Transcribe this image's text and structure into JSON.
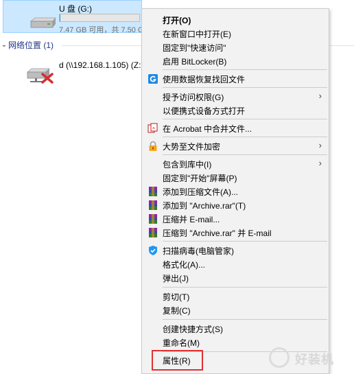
{
  "explorer": {
    "drive": {
      "name": "U 盘 (G:)",
      "info": "7.47 GB 可用，共 7.50 GB",
      "used_fraction": 0.01
    },
    "network_group": {
      "label": "网络位置 (1)"
    },
    "network_drive": {
      "label": "d (\\\\192.168.1.105) (Z:)"
    }
  },
  "menu": {
    "items": [
      {
        "label": "打开(O)"
      },
      {
        "label": "在新窗口中打开(E)"
      },
      {
        "label": "固定到\"快速访问\""
      },
      {
        "label": "启用 BitLocker(B)"
      },
      {
        "label": "使用数据恢复找回文件",
        "icon": "recovery-icon"
      },
      {
        "label": "授予访问权限(G)",
        "submenu": true
      },
      {
        "label": "以便携式设备方式打开"
      },
      {
        "label": "在 Acrobat 中合并文件...",
        "icon": "acrobat-icon"
      },
      {
        "label": "大势至文件加密",
        "icon": "lock-icon",
        "submenu": true
      },
      {
        "label": "包含到库中(I)",
        "submenu": true
      },
      {
        "label": "固定到\"开始\"屏幕(P)"
      },
      {
        "label": "添加到压缩文件(A)...",
        "icon": "winrar-icon"
      },
      {
        "label": "添加到 \"Archive.rar\"(T)",
        "icon": "winrar-icon"
      },
      {
        "label": "压缩并 E-mail...",
        "icon": "winrar-icon"
      },
      {
        "label": "压缩到 \"Archive.rar\" 并 E-mail",
        "icon": "winrar-icon"
      },
      {
        "label": "扫描病毒(电脑管家)",
        "icon": "shield-icon"
      },
      {
        "label": "格式化(A)..."
      },
      {
        "label": "弹出(J)"
      },
      {
        "label": "剪切(T)"
      },
      {
        "label": "复制(C)"
      },
      {
        "label": "创建快捷方式(S)"
      },
      {
        "label": "重命名(M)"
      },
      {
        "label": "属性(R)"
      }
    ],
    "submenu_arrow": "›"
  },
  "watermark": {
    "text": "好装机"
  },
  "colors": {
    "selection": "#cce8ff",
    "menu_bg": "#f2f2f2",
    "highlight_box": "#e03030",
    "recovery_blue": "#1e88e5",
    "shield_blue": "#2196f3"
  }
}
